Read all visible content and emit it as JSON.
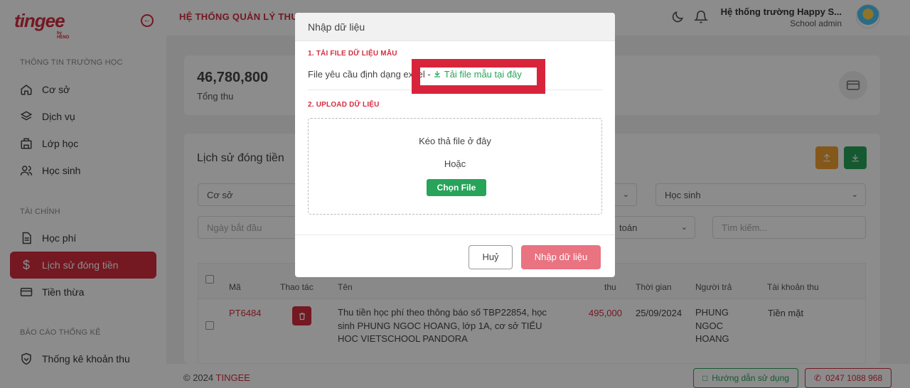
{
  "brand": {
    "logo": "tingee",
    "logo_sub": "by HENO"
  },
  "sidebar": {
    "sections": [
      {
        "title": "THÔNG TIN TRƯỜNG HỌC"
      },
      {
        "title": "TÀI CHÍNH"
      },
      {
        "title": "BÁO CÁO THỐNG KÊ"
      }
    ],
    "items": [
      {
        "label": "Cơ sở",
        "icon": "home-icon"
      },
      {
        "label": "Dịch vụ",
        "icon": "layers-icon"
      },
      {
        "label": "Lớp học",
        "icon": "building-icon"
      },
      {
        "label": "Học sinh",
        "icon": "users-icon"
      },
      {
        "label": "Học phí",
        "icon": "document-icon"
      },
      {
        "label": "Lịch sử đóng tiền",
        "icon": "dollar-icon",
        "active": true
      },
      {
        "label": "Tiền thừa",
        "icon": "card-icon"
      },
      {
        "label": "Thống kê khoản thu",
        "icon": "shield-icon"
      }
    ]
  },
  "header": {
    "title": "HỆ THỐNG QUẢN LÝ THU",
    "school_name": "Hệ thống trường Happy S...",
    "role": "School admin"
  },
  "summary": {
    "value": "46,780,800",
    "label": "Tổng thu"
  },
  "history": {
    "title": "Lịch sử đóng tiền",
    "filters": {
      "campus": "Cơ sở",
      "student": "Học sinh",
      "start_date": "Ngày bắt đầu",
      "account_tail": "toán",
      "search": "Tìm kiếm..."
    },
    "columns": [
      "Mã",
      "Thao tác",
      "Tên",
      "thu",
      "Thời gian",
      "Người trả",
      "Tài khoản thu"
    ],
    "rows": [
      {
        "code": "PT6484",
        "name_lines": [
          "Thu tiền học phí theo thông báo số TBP22854, học",
          "sinh PHUNG NGOC HOANG, lớp 1A, cơ sở TIỂU",
          "HOC VIETSCHOOL PANDORA"
        ],
        "amount": "495,000",
        "time": "25/09/2024",
        "payer_lines": [
          "PHUNG",
          "NGOC",
          "HOANG"
        ],
        "account": "Tiền mặt"
      }
    ]
  },
  "footer": {
    "copyright": "© 2024",
    "brand": "TINGEE",
    "guide": "Hướng dẫn sử dụng",
    "phone": "0247 1088 968"
  },
  "modal": {
    "title": "Nhập dữ liệu",
    "step1": "1. TẢI FILE DỮ LIỆU MẪU",
    "file_req": "File yêu cầu định dạng excel - ",
    "download_link": "Tải file mẫu tại đây",
    "step2": "2. UPLOAD DỮ LIỆU",
    "drop_text": "Kéo thả file ở đây",
    "or_text": "Hoặc",
    "choose_file": "Chọn File",
    "cancel": "Huỷ",
    "submit": "Nhập dữ liệu"
  },
  "colors": {
    "brand_red": "#d42d3f",
    "green": "#27a35a",
    "orange": "#f0a030"
  }
}
